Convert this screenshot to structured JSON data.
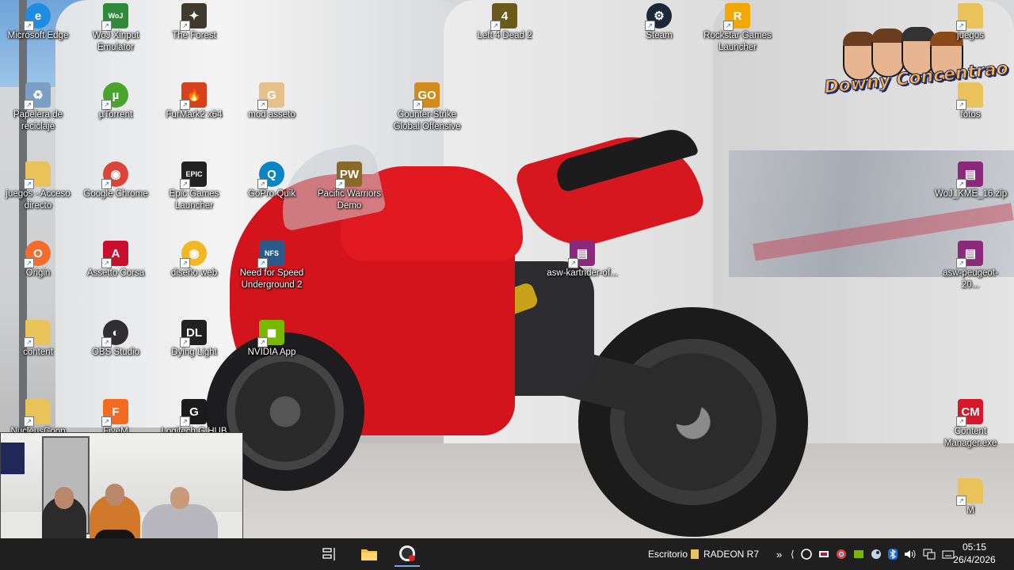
{
  "desktop": {
    "icons": [
      {
        "label": "Microsoft Edge",
        "icon": "edge-icon",
        "color": "#1c8de0"
      },
      {
        "label": "WoJ Xinput Emulator",
        "icon": "woj-icon",
        "color": "#2f8b3a"
      },
      {
        "label": "The Forest",
        "icon": "forest-icon",
        "color": "#3f3a2b"
      },
      {
        "label": "Left 4 Dead 2",
        "icon": "l4d2-icon",
        "color": "#6b5b1a"
      },
      {
        "label": "Steam",
        "icon": "steam-icon",
        "color": "#1b2838"
      },
      {
        "label": "Rockstar Games Launcher",
        "icon": "rockstar-icon",
        "color": "#f1a800"
      },
      {
        "label": "juegos",
        "icon": "folder-icon",
        "color": "#e9c25a"
      },
      {
        "label": "Papelera de reciclaje",
        "icon": "recycle-bin-icon",
        "color": "#7aa0c8"
      },
      {
        "label": "µTorrent",
        "icon": "utorrent-icon",
        "color": "#49a42c"
      },
      {
        "label": "FurMark2 x64",
        "icon": "furmark-icon",
        "color": "#d6401c"
      },
      {
        "label": "mod asseto",
        "icon": "logitech-icon",
        "color": "#e6c28a"
      },
      {
        "label": "Counter-Strike Global Offensive",
        "icon": "csgo-icon",
        "color": "#d18a1c"
      },
      {
        "label": "fotos",
        "icon": "folder-icon",
        "color": "#e9c25a"
      },
      {
        "label": "juegos - Acceso directo",
        "icon": "folder-icon",
        "color": "#e9c25a"
      },
      {
        "label": "Google Chrome",
        "icon": "chrome-icon",
        "color": "#db4437"
      },
      {
        "label": "Epic Games Launcher",
        "icon": "epic-icon",
        "color": "#222222"
      },
      {
        "label": "GoPro Quik",
        "icon": "gopro-icon",
        "color": "#0a84c2"
      },
      {
        "label": "Pacific Warriors Demo",
        "icon": "pacific-warriors-icon",
        "color": "#8a6a2a"
      },
      {
        "label": "WoJ_KME_16.zip",
        "icon": "winrar-icon",
        "color": "#8b2a7b"
      },
      {
        "label": "Origin",
        "icon": "origin-icon",
        "color": "#f56c2d"
      },
      {
        "label": "Assetto Corsa",
        "icon": "assetto-corsa-icon",
        "color": "#c8102e"
      },
      {
        "label": "diseño web",
        "icon": "chrome-icon",
        "color": "#f2b824"
      },
      {
        "label": "Need for Speed Underground 2",
        "icon": "nfs-icon",
        "color": "#2a5a8a"
      },
      {
        "label": "asw-kartrider-of...",
        "icon": "winrar-icon",
        "color": "#8b2a7b"
      },
      {
        "label": "asw-peugeot-20...",
        "icon": "winrar-icon",
        "color": "#8b2a7b"
      },
      {
        "label": "content",
        "icon": "folder-icon",
        "color": "#e9c25a"
      },
      {
        "label": "OBS Studio",
        "icon": "obs-icon",
        "color": "#302e31"
      },
      {
        "label": "Dying Light",
        "icon": "dying-light-icon",
        "color": "#222222"
      },
      {
        "label": "NVIDIA App",
        "icon": "nvidia-icon",
        "color": "#76b900"
      },
      {
        "label": "NucleusCoop",
        "icon": "folder-icon",
        "color": "#e9c25a"
      },
      {
        "label": "FiveM",
        "icon": "fivem-icon",
        "color": "#f26b21"
      },
      {
        "label": "Logitech G HUB",
        "icon": "logitech-ghub-icon",
        "color": "#1b1b1b"
      },
      {
        "label": "Content Manager.exe",
        "icon": "content-manager-icon",
        "color": "#d6192a"
      },
      {
        "label": "M",
        "icon": "file-icon",
        "color": "#e9c25a"
      }
    ]
  },
  "overlay_logo": {
    "text": "Downy Concentrao"
  },
  "taskbar": {
    "task_view_icon": "task-view-icon",
    "pinned": [
      {
        "name": "file-explorer",
        "icon": "folder-icon"
      },
      {
        "name": "obs",
        "icon": "obs-icon"
      }
    ],
    "toolbar_label": "Escritorio",
    "radeon_label": "RADEON R7",
    "overflow_chevron": "»",
    "tray_icons": [
      "logitech-icon",
      "assetto-icon",
      "chrome-icon",
      "nvidia-icon",
      "steam-icon",
      "bluetooth-icon",
      "volume-icon",
      "network-icon",
      "keyboard-icon"
    ],
    "time": "05:15",
    "date": "26/4/2026"
  },
  "colors": {
    "taskbar": "#1f1f20",
    "accent": "#d4141c"
  }
}
